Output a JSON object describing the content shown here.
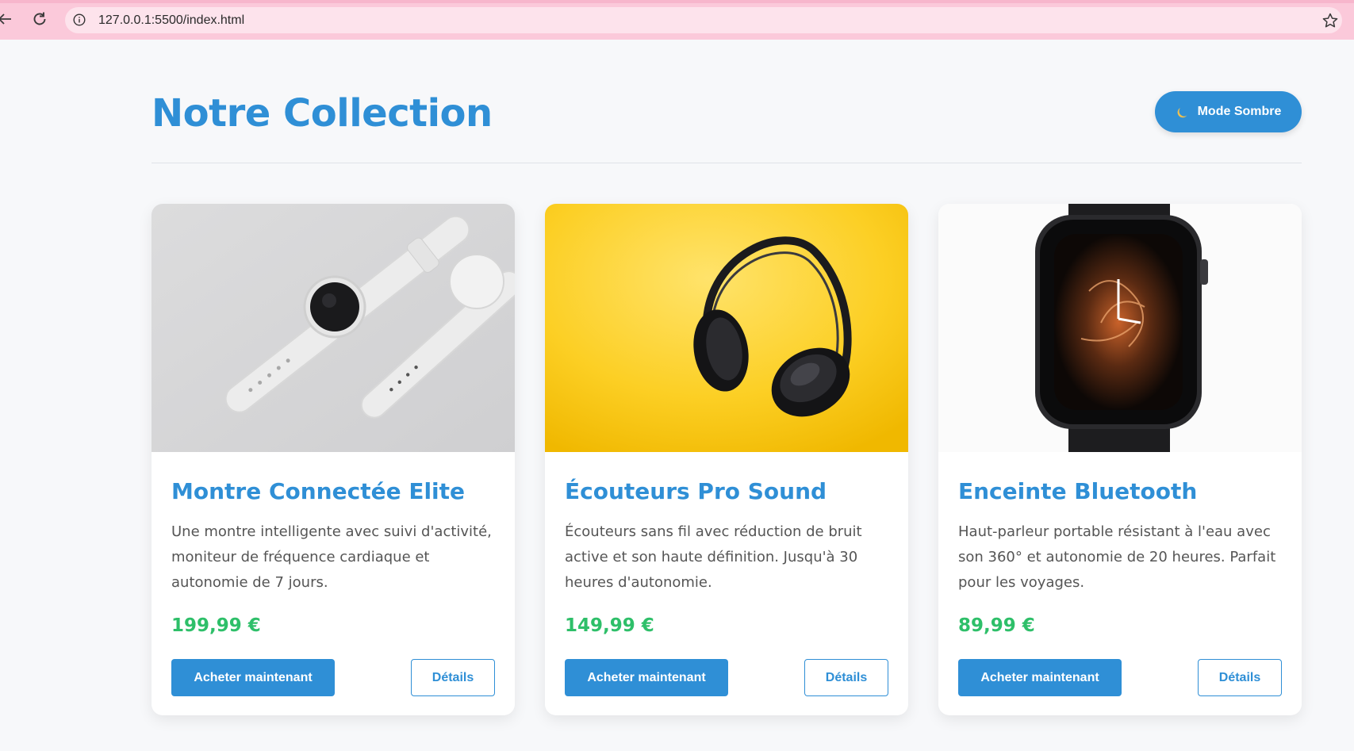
{
  "browser": {
    "url": "127.0.0.1:5500/index.html",
    "bar_color": "#fbc9da"
  },
  "header": {
    "title": "Notre Collection",
    "mode_button_label": "Mode Sombre",
    "mode_button_icon": "moon-icon"
  },
  "colors": {
    "accent": "#2f8fd6",
    "price": "#2ebf69",
    "background": "#f7f8fa"
  },
  "products": [
    {
      "name": "Montre Connectée Elite",
      "description": "Une montre intelligente avec suivi d'activité, moniteur de fréquence cardiaque et autonomie de 7 jours.",
      "price": "199,99 €",
      "buy_label": "Acheter maintenant",
      "details_label": "Détails",
      "image": "white-smartwatch-photo"
    },
    {
      "name": "Écouteurs Pro Sound",
      "description": "Écouteurs sans fil avec réduction de bruit active et son haute définition. Jusqu'à 30 heures d'autonomie.",
      "price": "149,99 €",
      "buy_label": "Acheter maintenant",
      "details_label": "Détails",
      "image": "black-headphones-on-yellow-photo"
    },
    {
      "name": "Enceinte Bluetooth",
      "description": "Haut-parleur portable résistant à l'eau avec son 360° et autonomie de 20 heures. Parfait pour les voyages.",
      "price": "89,99 €",
      "buy_label": "Acheter maintenant",
      "details_label": "Détails",
      "image": "black-smartwatch-photo"
    }
  ]
}
